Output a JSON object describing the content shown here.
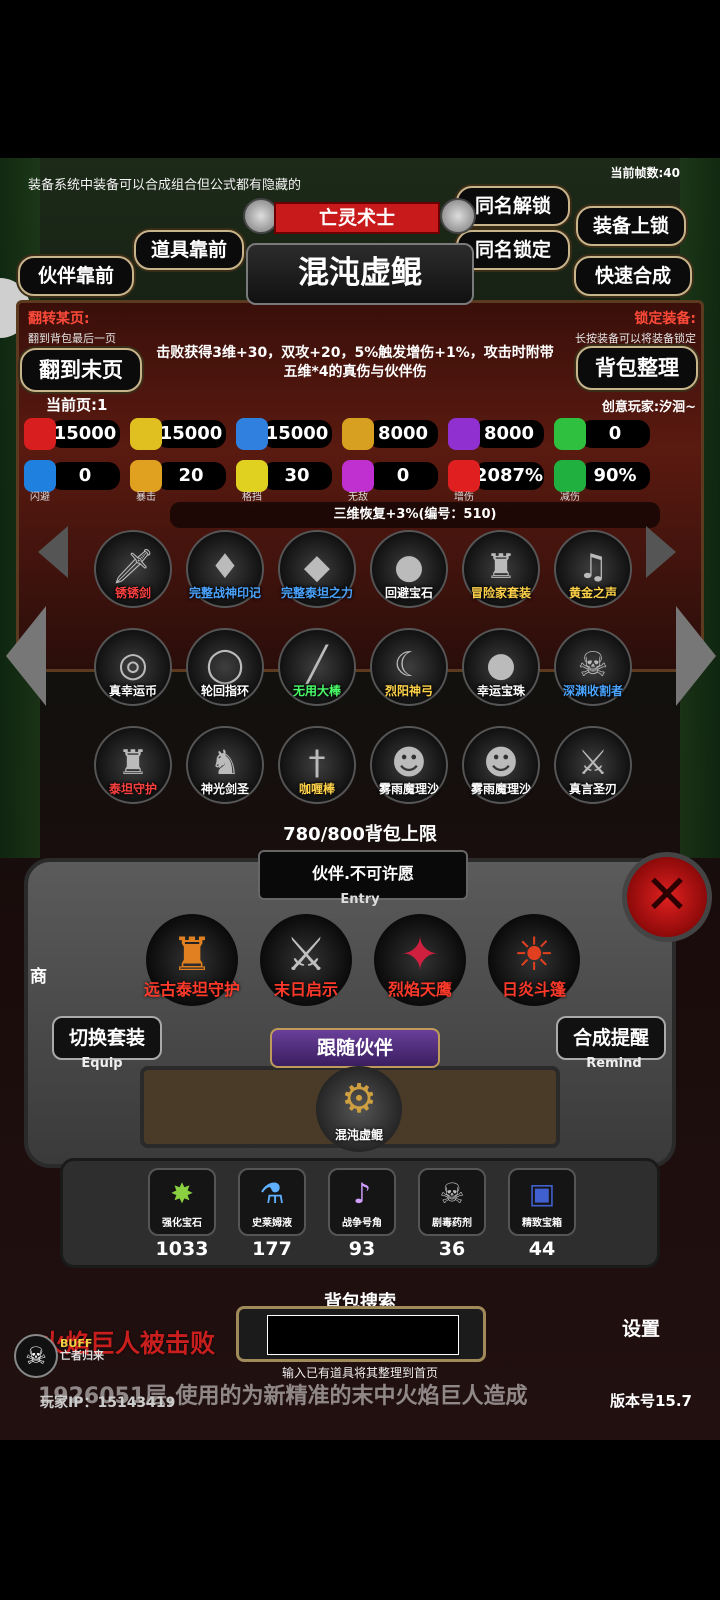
{
  "hud": {
    "tip": "装备系统中装备可以合成组合但公式都有隐藏的",
    "fps": "当前帧数:40",
    "class_name": "亡灵术士",
    "hero_name": "混沌虚鲲"
  },
  "buttons": {
    "same_name_unlock": "同名解锁",
    "same_name_lock": "同名锁定",
    "equip_lock": "装备上锁",
    "quick_merge": "快速合成",
    "items_front": "道具靠前",
    "partner_front": "伙伴靠前",
    "goto_last": "翻到末页",
    "sort_bag": "背包整理"
  },
  "banner": {
    "flip_title": "翻转某页:",
    "flip_note": "翻到背包最后一页",
    "lock_title": "锁定装备:",
    "lock_note": "长按装备可以将装备锁定",
    "effect": "击败获得3维+30，双攻+20，5%触发增伤+1%，攻击时附带五维*4的真伤与伙伴伤",
    "current_page": "当前页:1",
    "creator": "创意玩家:汐洄~",
    "regen": "三维恢复+3%(编号：510)"
  },
  "stats_row1": [
    {
      "icon": "heart-icon",
      "value": "15000",
      "color": "#d81e1e"
    },
    {
      "icon": "armor-icon",
      "value": "15000",
      "color": "#e0c020"
    },
    {
      "icon": "helmet-icon",
      "value": "15000",
      "color": "#3080e0"
    },
    {
      "icon": "sword-icon",
      "value": "8000",
      "color": "#d8a020"
    },
    {
      "icon": "lightning-icon",
      "value": "8000",
      "color": "#9030d0"
    },
    {
      "icon": "clover-icon",
      "value": "0",
      "color": "#30c040"
    }
  ],
  "stats_row2": [
    {
      "icon": "dodge-icon",
      "value": "0",
      "label": "闪避",
      "color": "#2080e0"
    },
    {
      "icon": "crit-icon",
      "value": "20",
      "label": "暴击",
      "color": "#e0a020"
    },
    {
      "icon": "block-icon",
      "value": "30",
      "label": "格挡",
      "color": "#e0d020"
    },
    {
      "icon": "invincible-icon",
      "value": "0",
      "label": "无敌",
      "color": "#c030d0"
    },
    {
      "icon": "damage-up-icon",
      "value": "2087%",
      "label": "增伤",
      "color": "#e02020"
    },
    {
      "icon": "damage-down-icon",
      "value": "90%",
      "label": "减伤",
      "color": "#20b040"
    }
  ],
  "items": [
    {
      "name": "锈锈剑",
      "glyph": "🗡",
      "color": "#ff4040"
    },
    {
      "name": "完整战神印记",
      "glyph": "♦",
      "color": "#4aa3ff"
    },
    {
      "name": "完整泰坦之力",
      "glyph": "◆",
      "color": "#4aa3ff"
    },
    {
      "name": "回避宝石",
      "glyph": "●",
      "color": "#ffffff"
    },
    {
      "name": "冒险家套装",
      "glyph": "♜",
      "color": "#ffd24a"
    },
    {
      "name": "黄金之声",
      "glyph": "♫",
      "color": "#ffd24a"
    },
    {
      "name": "真幸运币",
      "glyph": "◎",
      "color": "#ffffff"
    },
    {
      "name": "轮回指环",
      "glyph": "◯",
      "color": "#ffffff"
    },
    {
      "name": "无用大棒",
      "glyph": "╱",
      "color": "#4aff6a"
    },
    {
      "name": "烈阳神弓",
      "glyph": "☾",
      "color": "#ffd24a"
    },
    {
      "name": "幸运宝珠",
      "glyph": "●",
      "color": "#ffffff"
    },
    {
      "name": "深渊收割者",
      "glyph": "☠",
      "color": "#4aa3ff"
    },
    {
      "name": "泰坦守护",
      "glyph": "♜",
      "color": "#ff4040"
    },
    {
      "name": "神光剑圣",
      "glyph": "♞",
      "color": "#ffffff"
    },
    {
      "name": "咖喱棒",
      "glyph": "†",
      "color": "#ffd24a"
    },
    {
      "name": "雾雨魔理沙",
      "glyph": "☻",
      "color": "#ffffff"
    },
    {
      "name": "雾雨魔理沙",
      "glyph": "☻",
      "color": "#ffffff"
    },
    {
      "name": "真言圣刃",
      "glyph": "⚔",
      "color": "#ffffff"
    }
  ],
  "bag_limit": "780/800背包上限",
  "entry": {
    "title": "伙伴.不可许愿",
    "label": "Entry"
  },
  "partners": [
    {
      "name": "远古泰坦守护",
      "glyph": "♜"
    },
    {
      "name": "末日启示",
      "glyph": "⚔"
    },
    {
      "name": "烈焰天鹰",
      "glyph": "✦"
    },
    {
      "name": "日炎斗篷",
      "glyph": "☀"
    }
  ],
  "equip_btn": {
    "label": "切换套装",
    "sub": "Equip"
  },
  "remind_btn": {
    "label": "合成提醒",
    "sub": "Remind"
  },
  "follow": {
    "title": "跟随伙伴",
    "name": "混沌虚鲲",
    "glyph": "⚙"
  },
  "materials": [
    {
      "name": "强化宝石",
      "count": "1033",
      "glyph": "✸",
      "color": "#8ad040"
    },
    {
      "name": "史莱姆液",
      "count": "177",
      "glyph": "⚗",
      "color": "#60b0ff"
    },
    {
      "name": "战争号角",
      "count": "93",
      "glyph": "♪",
      "color": "#d0a0ff"
    },
    {
      "name": "剧毒药剂",
      "count": "36",
      "glyph": "☠",
      "color": "#c0c0c0"
    },
    {
      "name": "精致宝箱",
      "count": "44",
      "glyph": "▣",
      "color": "#4060d0"
    }
  ],
  "search": {
    "title": "背包搜索",
    "value": "",
    "hint": "输入已有道具将其整理到首页"
  },
  "footer": {
    "kill_msg": "火焰巨人被击败",
    "scroll_msg": "1926051层,使用的为新精准的末中火焰巨人造成",
    "player_ip": "玩家IP：15143419",
    "version": "版本号15.7",
    "buff": "BUFF",
    "buff_sub": "亡者归来",
    "settings": "设置",
    "shop": "商"
  }
}
